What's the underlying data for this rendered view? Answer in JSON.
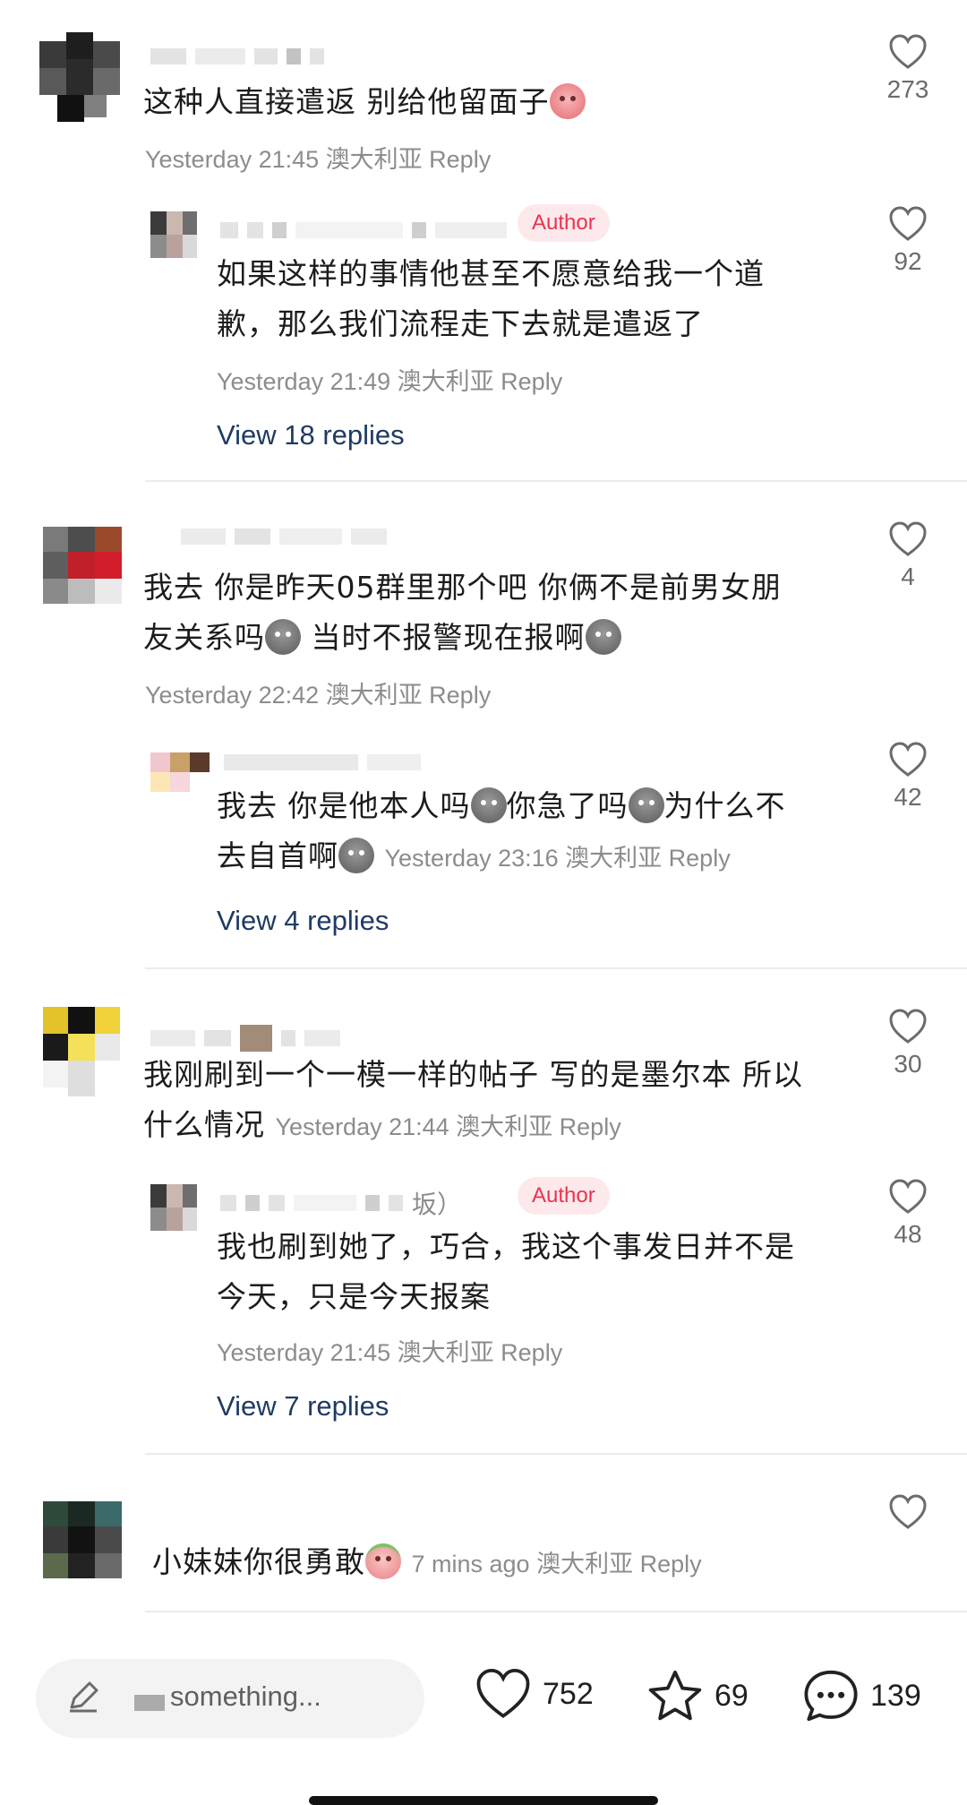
{
  "colors": {
    "author_badge_bg": "#fde9ec",
    "author_badge_text": "#e8344f",
    "view_replies": "#1f3b63",
    "meta": "#8c8c8c"
  },
  "comments": [
    {
      "text": "这种人直接遣返 别给他留面子",
      "emoji": "pink-face",
      "meta": "Yesterday 21:45 澳大利亚",
      "reply_label": "Reply",
      "likes": "273"
    },
    {
      "author_badge": "Author",
      "text": "如果这样的事情他甚至不愿意给我一个道歉，那么我们流程走下去就是遣返了",
      "line1": "如果这样的事情他甚至不愿意给我一个道",
      "line2": "歉，那么我们流程走下去就是遣返了",
      "meta": "Yesterday 21:49 澳大利亚",
      "reply_label": "Reply",
      "likes": "92",
      "view_replies": "View 18 replies"
    },
    {
      "line1": "我去 你是昨天05群里那个吧 你俩不是前男女朋",
      "line2a": "友关系吗",
      "line2b": " 当时不报警现在报啊",
      "meta": "Yesterday 22:42 澳大利亚",
      "reply_label": "Reply",
      "likes": "4"
    },
    {
      "line1a": "我去 你是他本人吗",
      "line1b": "你急了吗",
      "line1c": "为什么不",
      "line2": "去自首啊",
      "meta": "Yesterday 23:16 澳大利亚",
      "reply_label": "Reply",
      "likes": "42",
      "view_replies": "View 4 replies"
    },
    {
      "line1": "我刚刷到一个一模一样的帖子 写的是墨尔本 所以",
      "line2": "什么情况",
      "meta": "Yesterday 21:44 澳大利亚",
      "reply_label": "Reply",
      "likes": "30"
    },
    {
      "author_badge": "Author",
      "name_fragment": "坂）",
      "line1": "我也刷到她了，巧合，我这个事发日并不是",
      "line2": "今天，只是今天报案",
      "meta": "Yesterday 21:45 澳大利亚",
      "reply_label": "Reply",
      "likes": "48",
      "view_replies": "View 7 replies"
    },
    {
      "text": "小妹妹你很勇敢",
      "emoji": "pink-face",
      "meta": "7 mins ago 澳大利亚",
      "reply_label": "Reply",
      "likes": ""
    }
  ],
  "bottom_bar": {
    "input_placeholder": "something...",
    "likes": "752",
    "stars": "69",
    "comments": "139",
    "icons": [
      "pencil-icon",
      "heart-icon",
      "star-icon",
      "chat-bubble-icon"
    ]
  }
}
